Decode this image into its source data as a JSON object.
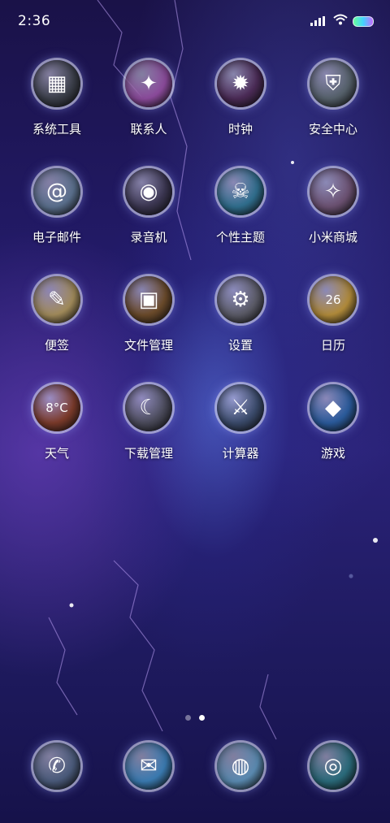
{
  "status_bar": {
    "time": "2:36"
  },
  "apps": [
    {
      "label": "系统工具",
      "icon": "tools-grid-icon",
      "glyph": "▦",
      "bg": "#3b3f4a"
    },
    {
      "label": "联系人",
      "icon": "contacts-fan-icon",
      "glyph": "✦",
      "bg": "#8a4a9a"
    },
    {
      "label": "时钟",
      "icon": "clock-spiked-ball-icon",
      "glyph": "✹",
      "bg": "#4a2a55"
    },
    {
      "label": "安全中心",
      "icon": "security-shield-icon",
      "glyph": "⛨",
      "bg": "#55606a"
    },
    {
      "label": "电子邮件",
      "icon": "email-at-icon",
      "glyph": "@",
      "bg": "#5a6f8c"
    },
    {
      "label": "录音机",
      "icon": "recorder-mic-icon",
      "glyph": "◉",
      "bg": "#3a3550"
    },
    {
      "label": "个性主题",
      "icon": "theme-skull-icon",
      "glyph": "☠",
      "bg": "#2f6d8c"
    },
    {
      "label": "小米商城",
      "icon": "store-emblem-icon",
      "glyph": "✧",
      "bg": "#6a5070"
    },
    {
      "label": "便签",
      "icon": "notes-scroll-icon",
      "glyph": "✎",
      "bg": "#a08a5a"
    },
    {
      "label": "文件管理",
      "icon": "file-chest-icon",
      "glyph": "▣",
      "bg": "#6a4a2a"
    },
    {
      "label": "设置",
      "icon": "settings-gear-icon",
      "glyph": "⚙",
      "bg": "#5a5a66"
    },
    {
      "label": "日历",
      "icon": "calendar-scroll-icon",
      "glyph": "26",
      "bg": "#b08a3a"
    },
    {
      "label": "天气",
      "icon": "weather-dragon-icon",
      "glyph": "8°C",
      "bg": "#7a3a2a"
    },
    {
      "label": "下载管理",
      "icon": "download-moon-icon",
      "glyph": "☾",
      "bg": "#4a4a5a"
    },
    {
      "label": "计算器",
      "icon": "calculator-swords-icon",
      "glyph": "⚔",
      "bg": "#3a4a6a"
    },
    {
      "label": "游戏",
      "icon": "game-crystal-icon",
      "glyph": "◆",
      "bg": "#2a5a9a"
    }
  ],
  "pager": {
    "count": 2,
    "active": 2
  },
  "dock": [
    {
      "icon": "phone-lightning-icon",
      "glyph": "✆",
      "bg": "#4a5a7a"
    },
    {
      "icon": "messages-crystal-icon",
      "glyph": "✉",
      "bg": "#3a7ab0"
    },
    {
      "icon": "browser-scroll-icon",
      "glyph": "◍",
      "bg": "#5a8ab0"
    },
    {
      "icon": "camera-orb-icon",
      "glyph": "◎",
      "bg": "#2a6a7a"
    }
  ]
}
